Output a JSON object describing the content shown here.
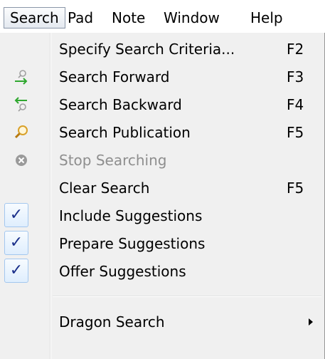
{
  "menubar": {
    "items": [
      "Search",
      "Pad",
      "Note",
      "Window",
      "Help"
    ],
    "active_index": 0
  },
  "menu": {
    "items": [
      {
        "label": "Specify Search Criteria...",
        "shortcut": "F2",
        "icon": "none",
        "enabled": true
      },
      {
        "label": "Search Forward",
        "shortcut": "F3",
        "icon": "search-forward-icon",
        "enabled": true
      },
      {
        "label": "Search Backward",
        "shortcut": "F4",
        "icon": "search-backward-icon",
        "enabled": true
      },
      {
        "label": "Search Publication",
        "shortcut": "F5",
        "icon": "magnifier-icon",
        "enabled": true
      },
      {
        "label": "Stop Searching",
        "shortcut": "",
        "icon": "stop-icon",
        "enabled": false
      },
      {
        "label": "Clear Search",
        "shortcut": "F5",
        "icon": "none",
        "enabled": true
      },
      {
        "label": "Include Suggestions",
        "shortcut": "",
        "icon": "checkmark-icon",
        "checked": true,
        "enabled": true
      },
      {
        "label": "Prepare Suggestions",
        "shortcut": "",
        "icon": "checkmark-icon",
        "checked": true,
        "enabled": true
      },
      {
        "label": "Offer Suggestions",
        "shortcut": "",
        "icon": "checkmark-icon",
        "checked": true,
        "enabled": true
      },
      {
        "label": "Dragon Search",
        "shortcut": "",
        "icon": "none",
        "submenu": true,
        "enabled": true
      }
    ]
  },
  "colors": {
    "menu_background": "#f0f0f0",
    "disabled_text": "#8e8e8e",
    "check_color": "#1a2f8a",
    "forward_arrow": "#2fa82f",
    "magnifier": "#d9a12a"
  }
}
